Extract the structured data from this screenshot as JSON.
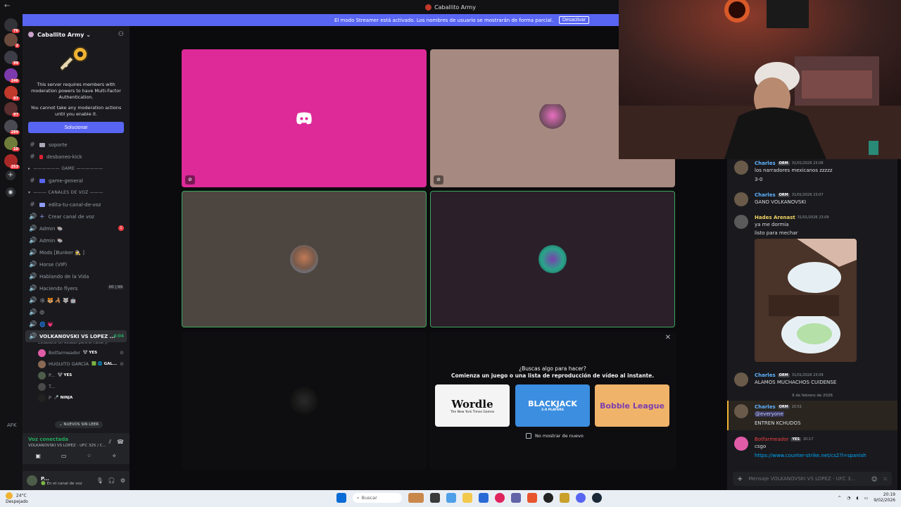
{
  "window": {
    "title": "Caballito Army",
    "back": "←"
  },
  "banner": {
    "text": "El modo Streamer está activado. Los nombres de usuario se mostrarán de forma parcial.",
    "button": "Desactivar"
  },
  "server": {
    "name": "Caballito Army ⌄"
  },
  "rail_badges": [
    "76",
    "2",
    "99",
    "246",
    "97",
    "97",
    "289",
    "10",
    "253"
  ],
  "mfa": {
    "line1": "This server requires members with moderation powers to have Multi-Factor Authentication.",
    "line2": "You cannot take any moderation actions until you enable it.",
    "button": "Solucionar"
  },
  "channels": {
    "soporte": "soporte",
    "desbaneo": "desbaneo-kick",
    "cat_game": "—————— GAME ——————",
    "game_general": "game-general",
    "cat_voice": "——— CANALES DE VOZ ———",
    "edita": "edita-tu-canal-de-voz",
    "crear": "Crear canal de voz",
    "admin1": "Admin 🐃",
    "admin1_badge": "1",
    "admin2": "Admin 🐃",
    "mods": "Mods [Bunker 🕵 ]",
    "horse": "Horse (VIP)",
    "hablando": "Hablando de la Vida",
    "haciendo": "Haciendo flyers",
    "haciendo_count": "00 | 99",
    "emoji1": "🕸 🐯 🦂 🐺 🤖",
    "emoji2": "😄",
    "emoji3": "🌀 💗",
    "active": "VOLKANOVSKI VS LOPEZ ...",
    "active_time": "4:04",
    "status_hint": "Establece un estado para el canal 🖉",
    "afk": "AFK",
    "new_unread": "⌄ NUEVOS SIN LEER"
  },
  "voice_users": [
    {
      "name": "Botfarmeador",
      "tag": "🐮 YES",
      "color": "#e05ca6"
    },
    {
      "name": "HUGUITO GARCÍA",
      "tag": "🟩 🌐 GAL...",
      "color": "#8a6a55"
    },
    {
      "name": "P...",
      "tag": "🐮 YES",
      "color": "#4e5d4a"
    },
    {
      "name": "T...",
      "tag": "",
      "color": "#4a4a4a"
    },
    {
      "name": "P",
      "tag": "🎤 NINJA",
      "color": "#222"
    }
  ],
  "voicebar": {
    "title": "Voz conectada",
    "subtitle": "VOLKANOVSKI VS LOPEZ - UFC 325 / C..."
  },
  "userbar": {
    "name": "P...",
    "status": "🟢 En el canal de voz"
  },
  "activity": {
    "question": "¿Buscas algo para hacer?",
    "subtitle": "Comienza un juego o una lista de reproducción de vídeo al instante.",
    "games": [
      "Wordle",
      "BLACKJACK",
      "Bobble League"
    ],
    "wordle_sub": "The New York Times Games",
    "blackjack_sub": "2-8 PLAYERS",
    "dont_show": "No mostrar de nuevo"
  },
  "chat": {
    "messages": [
      {
        "author": "Charles",
        "role": "ORM",
        "time": "31/01/2026 23:08",
        "lines": [
          "los narradores mexicanos zzzzz",
          "3-0"
        ],
        "color": "#5fb3ff"
      },
      {
        "author": "Charles",
        "role": "ORM",
        "time": "31/01/2026 23:07",
        "lines": [
          "GANO VOLKANOVSKI"
        ],
        "color": "#5fb3ff"
      },
      {
        "author": "Hades Arenast",
        "role": "",
        "time": "31/01/2026 23:09",
        "lines": [
          "ya me dormia",
          "listo para mechar"
        ],
        "color": "#f0d264"
      },
      {
        "author": "Charles",
        "role": "ORM",
        "time": "31/01/2026 23:09",
        "lines": [
          "ALAMOS MUCHACHOS CUIDENSE"
        ],
        "color": "#5fb3ff"
      },
      {
        "author": "Charles",
        "role": "ORM",
        "time": "20:51",
        "lines": [
          "@everyone",
          "ENTREN KCHUDOS"
        ],
        "color": "#5fb3ff"
      },
      {
        "author": "Botfarmeador",
        "role": "YES",
        "time": "20:17",
        "lines": [
          "csgo",
          "https://www.counter-strike.net/cs2?l=spanish"
        ],
        "color": "#f23f43"
      }
    ],
    "date_separator": "9 de febrero de 2026",
    "input_placeholder": "Mensaje VOLKANOVSKI VS LOPEZ - UFC 3..."
  },
  "taskbar": {
    "temp": "24°C",
    "weather": "Despejado",
    "search": "Buscar",
    "time": "20:19",
    "date": "9/02/2026"
  },
  "colors": {
    "blurple": "#5865f2",
    "tile_pink": "#dd2a98",
    "tile_taupe": "#a68980",
    "tile_brown": "#4d4640",
    "tile_plum": "#2b1f2a",
    "speaking_green": "#3ba55d"
  }
}
